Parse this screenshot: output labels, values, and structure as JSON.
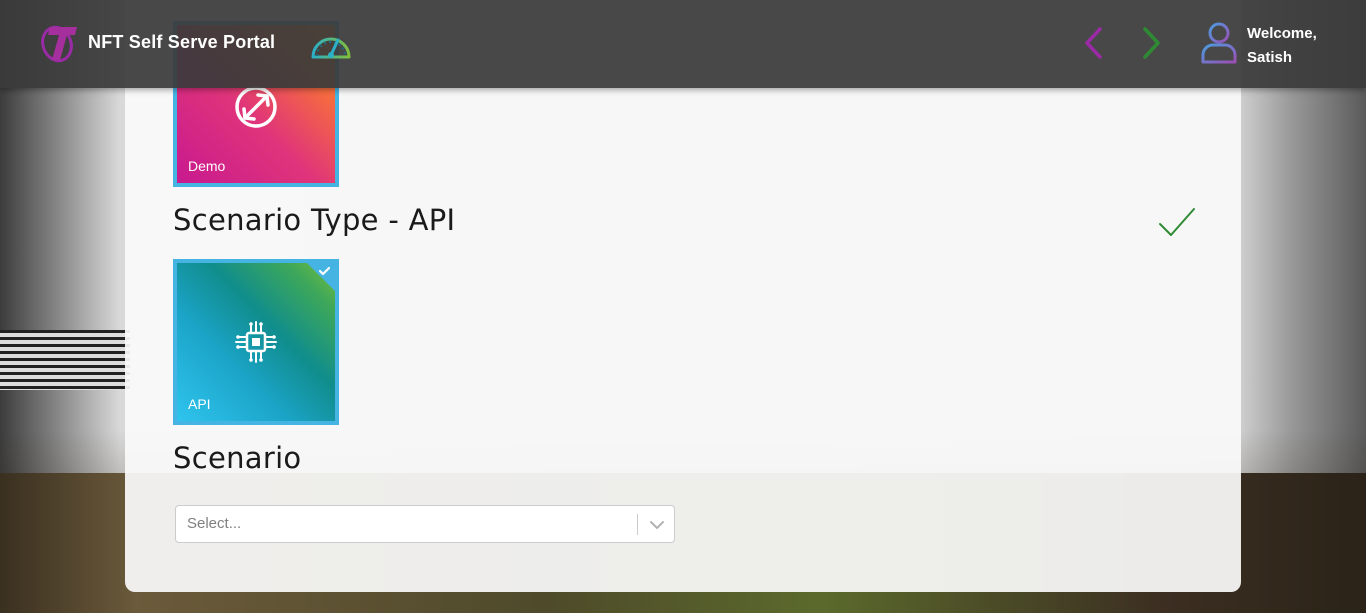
{
  "header": {
    "app_title": "NFT Self Serve Portal",
    "welcome_line1": "Welcome,",
    "welcome_line2": "Satish",
    "icons": [
      "telstra-logo",
      "speedometer-icon",
      "chevron-left-icon",
      "chevron-right-icon",
      "user-icon"
    ],
    "colors": {
      "bar": "#3a3a3a",
      "back_arrow": "#9b2aa6",
      "forward_arrow": "#2e8b34"
    }
  },
  "tiles": [
    {
      "label": "Demo",
      "icon": "demo-cycle-icon",
      "selected": false
    },
    {
      "label": "API",
      "icon": "circuit-chip-icon",
      "selected": true
    }
  ],
  "sections": {
    "scenario_type_title": "Scenario Type - API",
    "scenario_title": "Scenario"
  },
  "scenario_select": {
    "placeholder": "Select..."
  },
  "colors": {
    "tile_border": "#45b4e3",
    "check_green": "#2e8b34"
  }
}
